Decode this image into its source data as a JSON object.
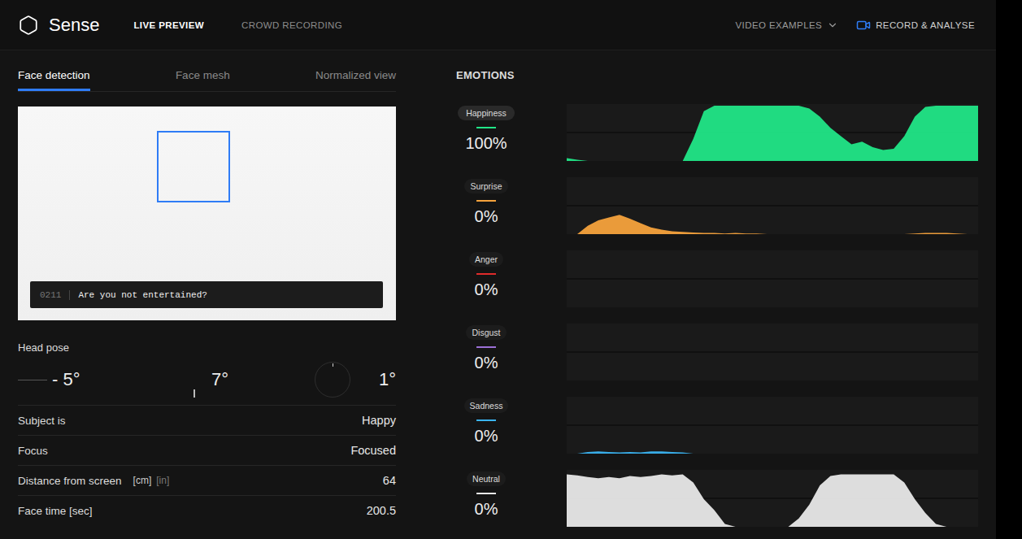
{
  "app": {
    "name": "Sense"
  },
  "nav": [
    {
      "label": "LIVE PREVIEW",
      "selected": true
    },
    {
      "label": "CROWD RECORDING",
      "selected": false
    }
  ],
  "actions": {
    "video_examples": {
      "label": "VIDEO EXAMPLES",
      "expanded": false
    },
    "record": {
      "label": "RECORD & ANALYSE"
    }
  },
  "view_tabs": [
    {
      "label": "Face detection",
      "selected": true
    },
    {
      "label": "Face mesh",
      "selected": false
    },
    {
      "label": "Normalized view",
      "selected": false
    }
  ],
  "video": {
    "caption": {
      "index": "0211",
      "text": "Are you not entertained?"
    }
  },
  "head_pose": {
    "label": "Head pose",
    "values": [
      {
        "kind": "yaw",
        "value": "- 5°"
      },
      {
        "kind": "pitch",
        "value": "7°"
      },
      {
        "kind": "roll",
        "value": "1°"
      }
    ]
  },
  "stats": [
    {
      "label": "Subject is",
      "units": [],
      "value": "Happy"
    },
    {
      "label": "Focus",
      "units": [],
      "value": "Focused"
    },
    {
      "label": "Distance from screen",
      "units": [
        {
          "label": "[cm]",
          "selected": true
        },
        {
          "label": "[in]",
          "selected": false
        }
      ],
      "value": "64"
    },
    {
      "label": "Face time [sec]",
      "units": [],
      "value": "200.5"
    }
  ],
  "emotions": {
    "title": "EMOTIONS",
    "items": [
      {
        "label": "Happiness",
        "value": "100%",
        "selected": true,
        "color": "#21e687",
        "values": [
          5,
          2,
          0,
          0,
          0,
          0,
          0,
          0,
          0,
          0,
          0,
          0,
          40,
          90,
          100,
          100,
          100,
          100,
          100,
          100,
          100,
          100,
          100,
          95,
          80,
          60,
          45,
          30,
          35,
          25,
          20,
          22,
          45,
          80,
          98,
          100,
          100,
          100,
          100,
          100
        ]
      },
      {
        "label": "Surprise",
        "value": "0%",
        "selected": false,
        "color": "#f5a23c",
        "values": [
          0,
          0,
          15,
          25,
          30,
          35,
          28,
          20,
          12,
          8,
          5,
          4,
          3,
          2,
          2,
          1,
          2,
          1,
          1,
          0,
          0,
          0,
          0,
          0,
          0,
          0,
          0,
          0,
          0,
          0,
          0,
          0,
          0,
          1,
          2,
          2,
          2,
          1,
          0,
          0
        ]
      },
      {
        "label": "Anger",
        "value": "0%",
        "selected": false,
        "color": "#e02b2b",
        "values": [
          0,
          0,
          0,
          0,
          0,
          0,
          0,
          0,
          0,
          0,
          0,
          0,
          0,
          0,
          0,
          0,
          0,
          0,
          0,
          0,
          0,
          0,
          0,
          0,
          0,
          0,
          0,
          0,
          0,
          0,
          0,
          0,
          0,
          0,
          0,
          0,
          0,
          0,
          0,
          0
        ]
      },
      {
        "label": "Disgust",
        "value": "0%",
        "selected": false,
        "color": "#9b6fd6",
        "values": [
          0,
          0,
          0,
          0,
          0,
          0,
          0,
          0,
          0,
          0,
          0,
          0,
          0,
          0,
          0,
          0,
          0,
          0,
          0,
          0,
          0,
          0,
          0,
          0,
          0,
          0,
          0,
          0,
          0,
          0,
          0,
          0,
          0,
          0,
          0,
          0,
          0,
          0,
          0,
          0
        ]
      },
      {
        "label": "Sadness",
        "value": "0%",
        "selected": false,
        "color": "#3ab4f2",
        "values": [
          0,
          0,
          3,
          4,
          3,
          2,
          3,
          2,
          4,
          4,
          3,
          2,
          0,
          0,
          0,
          0,
          0,
          0,
          0,
          0,
          0,
          0,
          0,
          0,
          0,
          0,
          0,
          0,
          0,
          0,
          0,
          0,
          0,
          0,
          0,
          0,
          0,
          0,
          0,
          0
        ]
      },
      {
        "label": "Neutral",
        "value": "0%",
        "selected": false,
        "color": "#e8e8e8",
        "values": [
          95,
          93,
          90,
          88,
          90,
          88,
          92,
          90,
          92,
          95,
          93,
          95,
          80,
          50,
          30,
          5,
          0,
          0,
          0,
          0,
          0,
          0,
          15,
          40,
          75,
          92,
          95,
          95,
          95,
          95,
          95,
          95,
          80,
          50,
          25,
          5,
          0,
          0,
          0,
          0
        ]
      }
    ]
  }
}
